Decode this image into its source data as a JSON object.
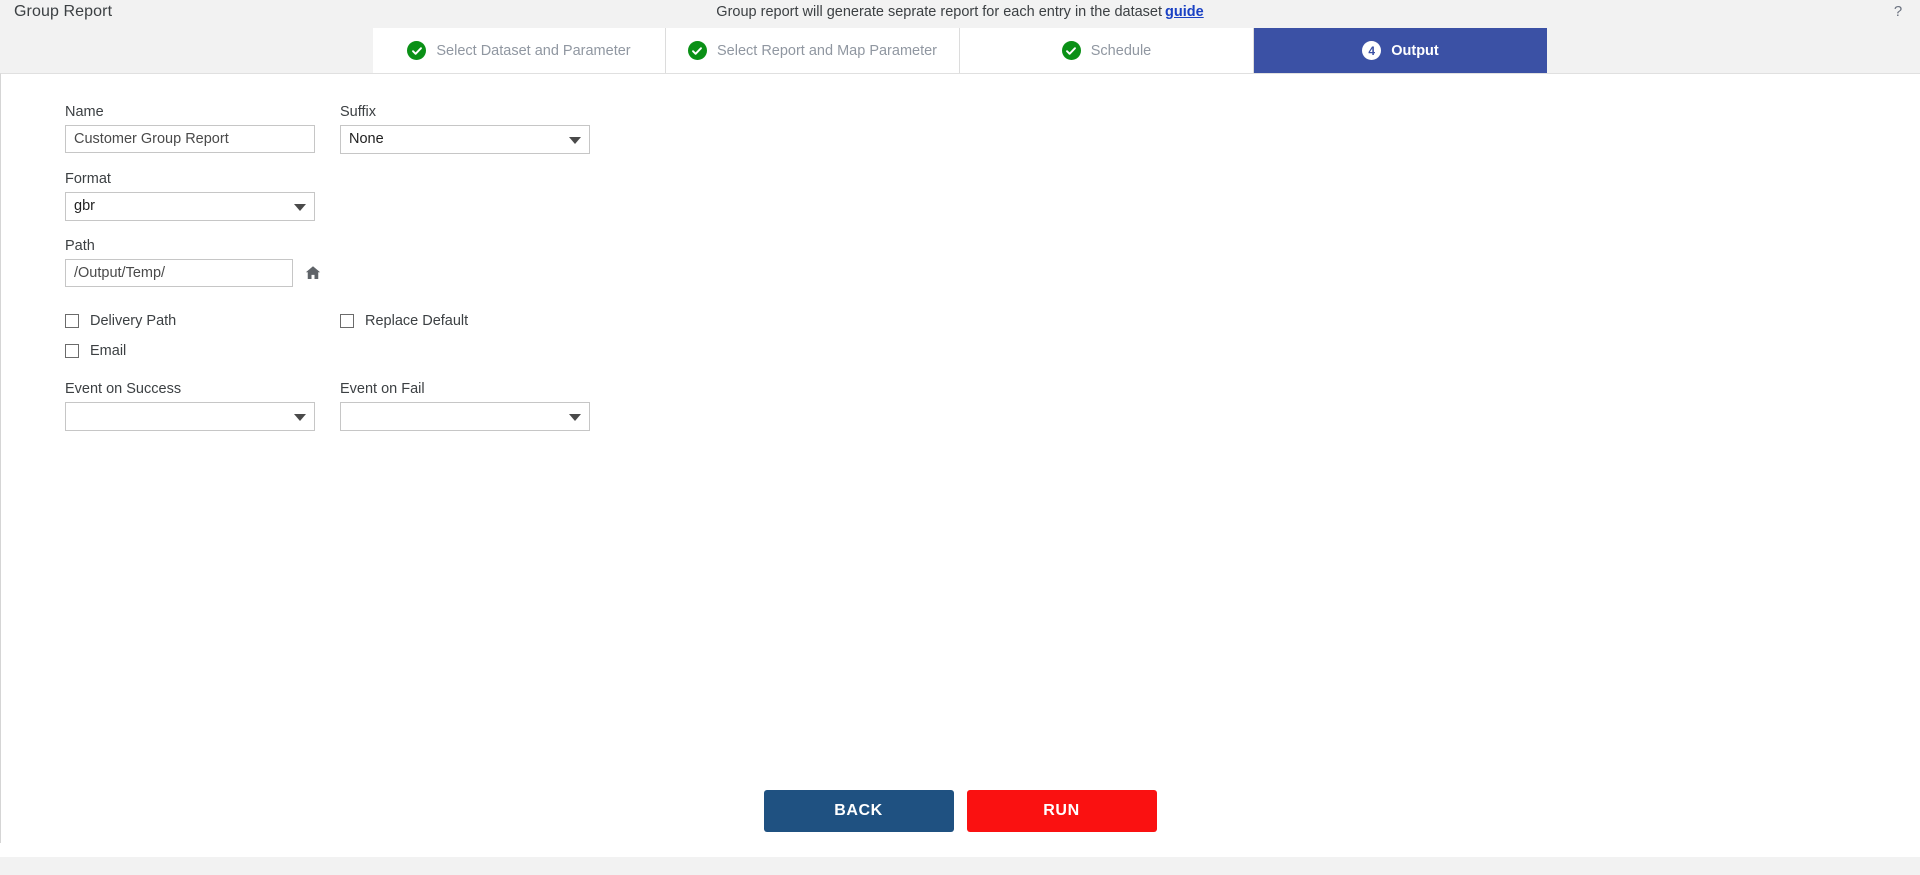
{
  "header": {
    "title": "Group Report",
    "notice_text": "Group report will generate seprate report for each entry in the dataset",
    "guide_link": "guide",
    "help_icon": "question-mark-icon",
    "help_glyph": "?"
  },
  "tabs": [
    {
      "label": "Select Dataset and Parameter",
      "state": "complete",
      "marker": "check-circle-icon"
    },
    {
      "label": "Select Report and Map Parameter",
      "state": "complete",
      "marker": "check-circle-icon"
    },
    {
      "label": "Schedule",
      "state": "complete",
      "marker": "check-circle-icon"
    },
    {
      "label": "Output",
      "state": "active",
      "marker": "4"
    }
  ],
  "form": {
    "name": {
      "label": "Name",
      "value": "Customer Group Report",
      "placeholder": ""
    },
    "suffix": {
      "label": "Suffix",
      "value": "None"
    },
    "format": {
      "label": "Format",
      "value": "gbr"
    },
    "path": {
      "label": "Path",
      "value": "/Output/Temp/",
      "home_icon": "home-icon"
    },
    "delivery_path": {
      "label": "Delivery Path",
      "checked": false
    },
    "replace_default": {
      "label": "Replace Default",
      "checked": false
    },
    "email": {
      "label": "Email",
      "checked": false
    },
    "event_on_success": {
      "label": "Event on Success",
      "value": ""
    },
    "event_on_fail": {
      "label": "Event on Fail",
      "value": ""
    }
  },
  "buttons": {
    "back": "BACK",
    "run": "RUN"
  },
  "colors": {
    "active_tab": "#3b51a5",
    "check_green": "#0a9016",
    "back_button": "#1f5181",
    "run_button": "#fa1111",
    "link": "#1a41c4",
    "chrome_gray": "#f2f2f2"
  }
}
